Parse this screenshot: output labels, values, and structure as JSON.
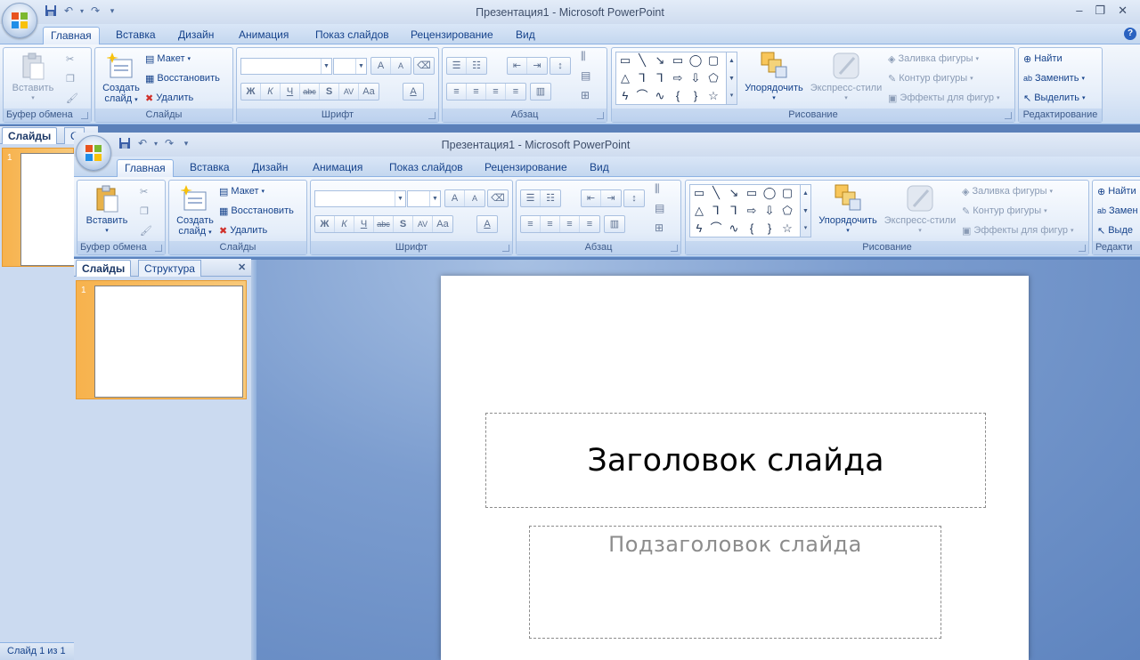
{
  "app": {
    "window_title": "Презентация1 - Microsoft PowerPoint"
  },
  "tabs": [
    "Главная",
    "Вставка",
    "Дизайн",
    "Анимация",
    "Показ слайдов",
    "Рецензирование",
    "Вид"
  ],
  "clipboard": {
    "paste_label": "Вставить",
    "group_label": "Буфер обмена"
  },
  "slides_group": {
    "new_slide_label_1": "Создать",
    "new_slide_label_2": "слайд",
    "layout_label": "Макет",
    "reset_label": "Восстановить",
    "delete_label": "Удалить",
    "group_label": "Слайды"
  },
  "font_group": {
    "group_label": "Шрифт",
    "bold": "Ж",
    "italic": "К",
    "underline": "Ч",
    "strike": "abc",
    "shadow": "S",
    "spacing": "AV",
    "case": "Aa",
    "grow": "A",
    "shrink": "A",
    "color": "A"
  },
  "paragraph_group": {
    "group_label": "Абзац"
  },
  "drawing_group": {
    "arrange_label": "Упорядочить",
    "quick_styles_label": "Экспресс-стили",
    "fill_label": "Заливка фигуры",
    "outline_label": "Контур фигуры",
    "effects_label": "Эффекты для фигур",
    "group_label": "Рисование"
  },
  "editing_group": {
    "find_label": "Найти",
    "replace_label": "Заменить",
    "select_label": "Выделить",
    "group_label": "Редактирование",
    "find_label_cut": "Найти",
    "replace_label_cut": "Замен",
    "select_label_cut": "Выде",
    "group_label_cut": "Редакти"
  },
  "panel": {
    "slides_tab": "Слайды",
    "outline_tab": "Структура",
    "outline_tab_cut": "С",
    "slide_number": "1"
  },
  "slide": {
    "title_placeholder": "Заголовок слайда",
    "subtitle_placeholder": "Подзаголовок слайда"
  },
  "status": {
    "slide_counter": "Слайд 1 из 1"
  },
  "colors": {
    "ribbon_text": "#15428b",
    "selection_orange": "#f7b24d",
    "workspace_blue": "#5b80b9"
  }
}
